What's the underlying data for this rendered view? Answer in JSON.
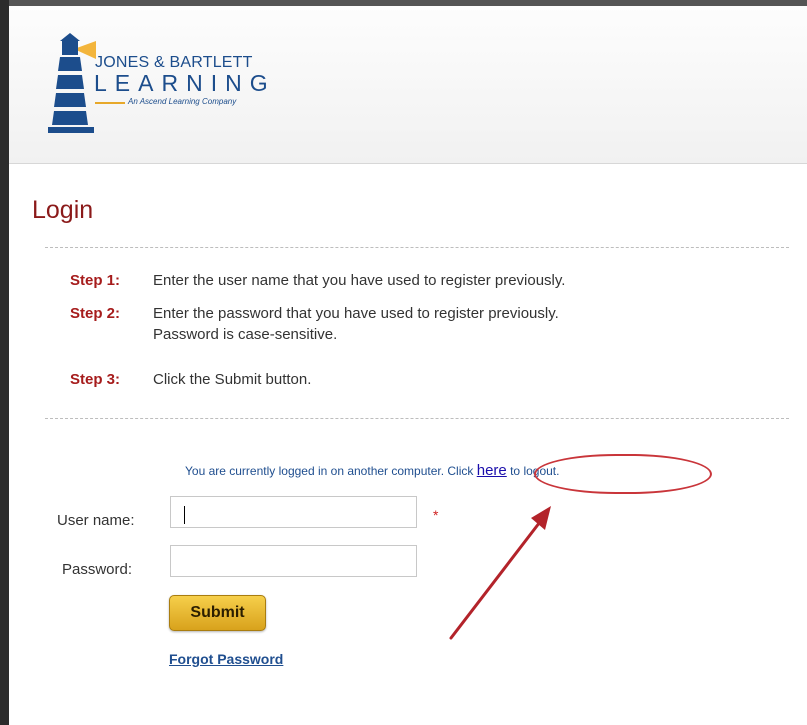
{
  "brand": {
    "line1": "JONES & BARTLETT",
    "line2": "LEARNING",
    "tagline": "An Ascend Learning Company"
  },
  "page": {
    "title": "Login"
  },
  "steps": [
    {
      "label": "Step 1:",
      "text": "Enter the user name that you have used to register previously."
    },
    {
      "label": "Step 2:",
      "text": "Enter the password that you have used to register previously.",
      "text2": "Password is case-sensitive."
    },
    {
      "label": "Step 3:",
      "text": "Click the Submit button."
    }
  ],
  "notice": {
    "prefix": "You are currently logged in on another computer. Click ",
    "link": "here",
    "suffix": " to logout."
  },
  "form": {
    "username_label": "User name:",
    "username_value": "",
    "required_marker": "*",
    "password_label": "Password:",
    "password_value": "",
    "submit_label": "Submit",
    "forgot_label": "Forgot Password"
  },
  "colors": {
    "title": "#8b1a1a",
    "step_label": "#a61c1c",
    "link_blue": "#1f4e8f",
    "annotation_red": "#c9353a",
    "submit_gold": "#d8a21c"
  },
  "icons": {
    "logo": "lighthouse-icon",
    "annotation": "red-arrow-icon"
  }
}
